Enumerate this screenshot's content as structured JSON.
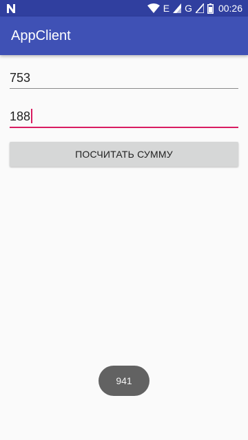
{
  "status_bar": {
    "left_icon": "n-notification-icon",
    "network_label_1": "E",
    "network_label_2": "G",
    "time": "00:26"
  },
  "app_bar": {
    "title": "AppClient"
  },
  "form": {
    "first_number": "753",
    "second_number": "188",
    "sum_button_label": "ПОСЧИТАТЬ СУММУ"
  },
  "toast": {
    "text": "941"
  },
  "colors": {
    "status_bar": "#303f9f",
    "app_bar": "#3f51b5",
    "accent": "#d81b60",
    "button": "#d6d7d7",
    "toast": "#626262"
  }
}
